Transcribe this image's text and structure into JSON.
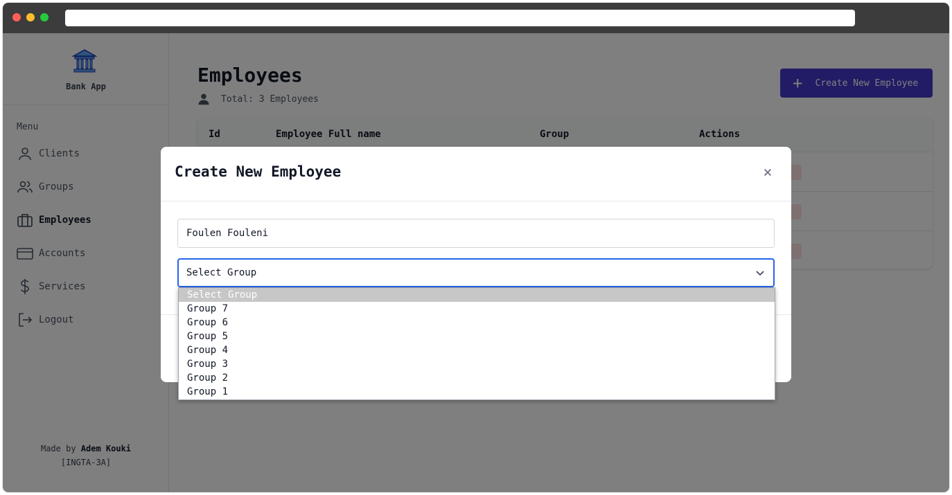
{
  "app": {
    "name": "Bank App"
  },
  "sidebar": {
    "menu_title": "Menu",
    "items": [
      {
        "label": "Clients",
        "icon": "user-icon"
      },
      {
        "label": "Groups",
        "icon": "users-icon"
      },
      {
        "label": "Employees",
        "icon": "briefcase-icon",
        "active": true
      },
      {
        "label": "Accounts",
        "icon": "credit-card-icon"
      },
      {
        "label": "Services",
        "icon": "dollar-icon"
      },
      {
        "label": "Logout",
        "icon": "logout-icon"
      }
    ],
    "footer": {
      "made_by": "Made by",
      "author": "Adem Kouki",
      "class": "[INGTA-3A]"
    }
  },
  "main": {
    "title": "Employees",
    "total": "Total: 3 Employees",
    "create_button": "Create New Employee",
    "table": {
      "headers": [
        "Id",
        "Employee Full name",
        "Group",
        "Actions"
      ]
    }
  },
  "modal": {
    "title": "Create New Employee",
    "name_value": "Foulen Fouleni",
    "select_value": "Select Group",
    "options": [
      "Select Group",
      "Group 7",
      "Group 6",
      "Group 5",
      "Group 4",
      "Group 3",
      "Group 2",
      "Group 1"
    ]
  },
  "colors": {
    "accent": "#4338ca",
    "focus": "#2563eb",
    "overlay": "rgba(0,0,0,0.5)"
  }
}
